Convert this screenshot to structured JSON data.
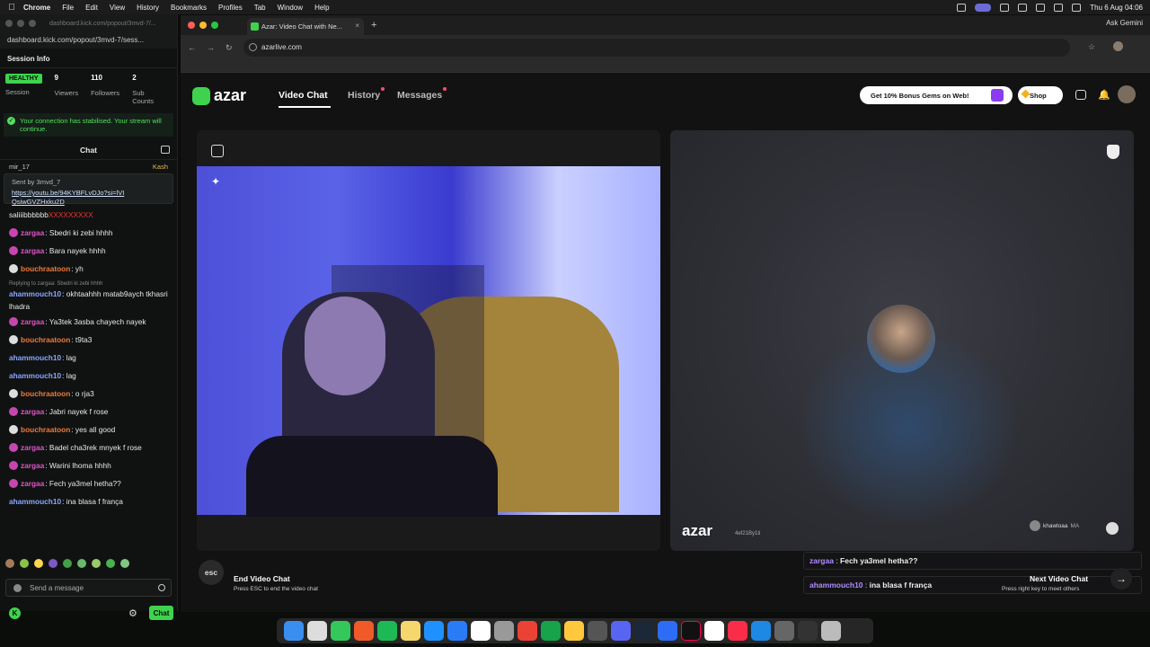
{
  "menubar": {
    "app": "Chrome",
    "items": [
      "File",
      "Edit",
      "View",
      "History",
      "Bookmarks",
      "Profiles",
      "Tab",
      "Window",
      "Help"
    ],
    "clock": "Thu 6 Aug  04:06"
  },
  "left_panel": {
    "url_top": "dashboard.kick.com/popout/3mvd-7/...",
    "url": "dashboard.kick.com/popout/3mvd-7/sess...",
    "session_title": "Session Info",
    "health_badge": "HEALTHY",
    "session_label": "Session",
    "viewers_value": "9",
    "viewers_label": "Viewers",
    "followers_value": "110",
    "followers_label": "Followers",
    "subs_value": "2",
    "subs_label": "Sub Counts",
    "notice": "Your connection has stabilised. Your stream will continue.",
    "chat_title": "Chat",
    "pin_user": "mir_17",
    "pin_right": "Kash",
    "pinned_by": "Sent by",
    "pinned_by_user": "3mvd_7",
    "pinned_link": "https://youtu.be/94KYBFLvDJo?si=lVIQsiwGVZHxku2D",
    "first_line": "saliiibbbbbb",
    "first_line_x": "XXXXXXXXX",
    "messages": [
      {
        "user": "zargaa",
        "text": ": Sbedri ki zebi hhhh",
        "ucls": "z",
        "av": "p"
      },
      {
        "user": "zargaa",
        "text": ": Bara nayek hhhh",
        "ucls": "z",
        "av": "p"
      },
      {
        "user": "bouchraatoon",
        "text": ": yh",
        "ucls": "b",
        "av": "w"
      }
    ],
    "reply_hint": "Replying to zargaa: Sbedri ki zebi hhhh",
    "wrap_user": "ahammouch10",
    "wrap_text": ": okhtaahhh matab9aych tkhasri lhadra",
    "messages2": [
      {
        "user": "zargaa",
        "text": ": Ya3tek 3asba chayech nayek",
        "ucls": "z",
        "av": "p"
      },
      {
        "user": "bouchraatoon",
        "text": ": t9ta3",
        "ucls": "b",
        "av": "w"
      },
      {
        "user": "ahammouch10",
        "text": ": lag",
        "ucls": "a",
        "av": ""
      },
      {
        "user": "ahammouch10",
        "text": ": lag",
        "ucls": "a",
        "av": ""
      },
      {
        "user": "bouchraatoon",
        "text": ": o rja3",
        "ucls": "b",
        "av": "w"
      },
      {
        "user": "zargaa",
        "text": ": Jabri nayek f rose",
        "ucls": "z",
        "av": "p"
      },
      {
        "user": "bouchraatoon",
        "text": ": yes all good",
        "ucls": "b",
        "av": "w"
      },
      {
        "user": "zargaa",
        "text": ": Badel cha3rek mnyek f rose",
        "ucls": "z",
        "av": "p"
      },
      {
        "user": "zargaa",
        "text": ": Warini lhoma hhhh",
        "ucls": "z",
        "av": "p"
      },
      {
        "user": "zargaa",
        "text": ": Fech ya3mel hetha??",
        "ucls": "z",
        "av": "p"
      },
      {
        "user": "ahammouch10",
        "text": ": ina blasa f frança",
        "ucls": "a",
        "av": ""
      }
    ],
    "send_placeholder": "Send a message",
    "chat_button": "Chat"
  },
  "browser": {
    "tab_title": "Azar: Video Chat with Ne...",
    "url": "azarlive.com",
    "ask_gemini": "Ask Gemini"
  },
  "azar": {
    "logo": "azar",
    "nav": [
      "Video Chat",
      "History",
      "Messages"
    ],
    "promo": "Get 10% Bonus Gems on Web!",
    "shop": "Shop",
    "watermark": "azar",
    "watermark_id": "4ef21By1ti",
    "peer_name": "khawloaa",
    "peer_sub": "MA",
    "chat_lines": [
      {
        "name": "zargaa",
        "text": "Fech ya3mel hetha??"
      },
      {
        "name": "ahammouch10",
        "text": "ina blasa f frança"
      }
    ],
    "esc": "esc",
    "end_title": "End Video Chat",
    "end_sub": "Press ESC to end the video chat",
    "next_title": "Next Video Chat",
    "next_sub": "Press right key to meet others"
  },
  "colors": {
    "kick_green": "#3fd34d",
    "zargaa": "#e055c8",
    "bouchraatoon": "#ee7a3a",
    "ahammouch10": "#8aa6ff"
  }
}
